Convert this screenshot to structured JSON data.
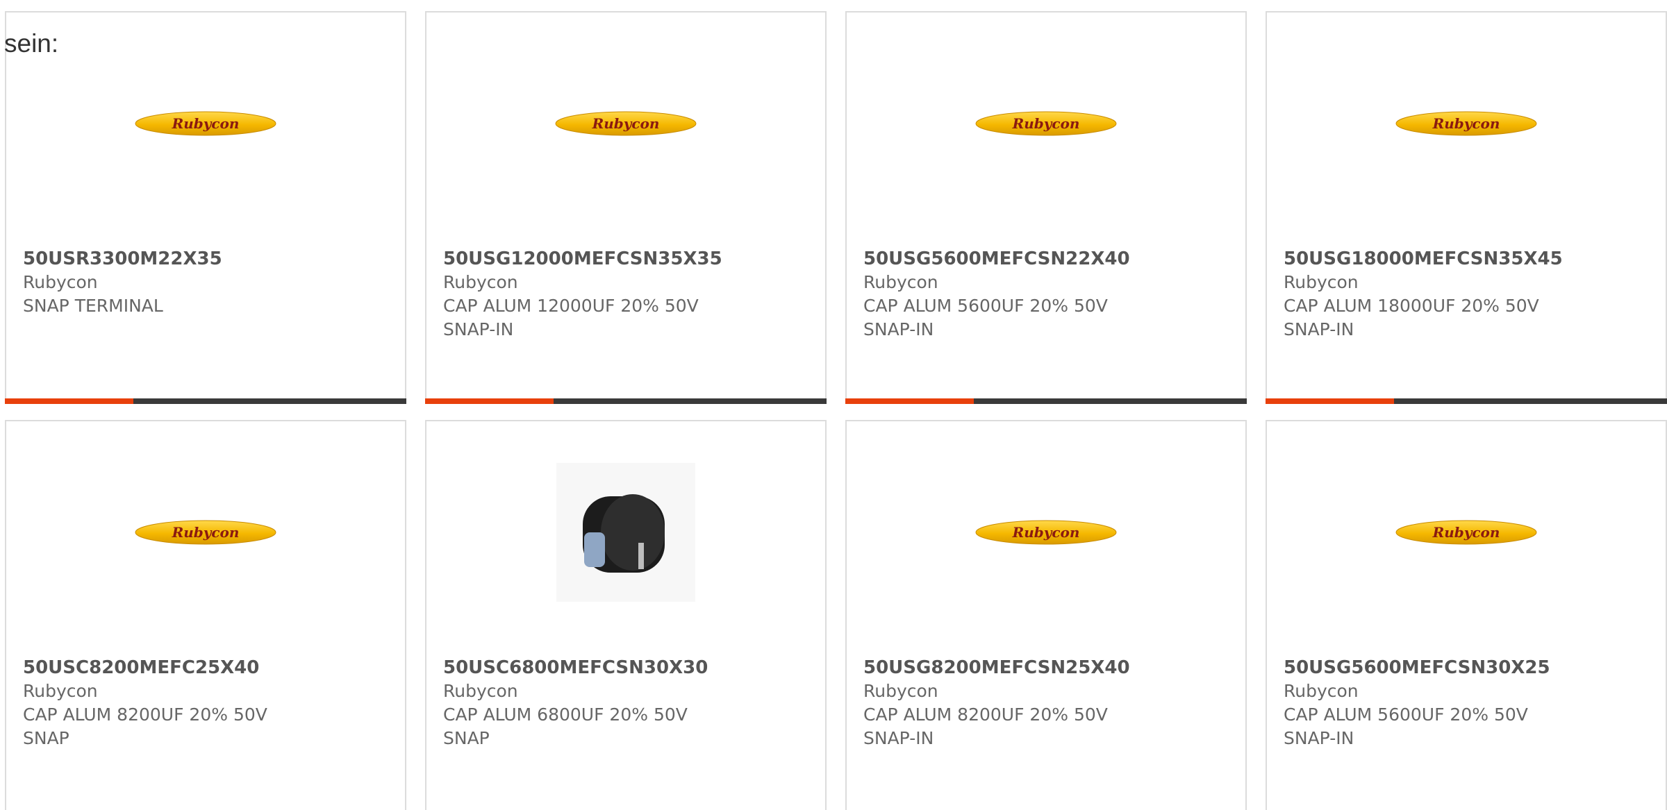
{
  "intro_text": "sein:",
  "colors": {
    "card_border": "#dcdcdc",
    "progress_track": "#3a3a3a",
    "progress_fill": "#e8400c",
    "logo_yellow": "#f5b800",
    "logo_text": "#8a1a10"
  },
  "products": [
    {
      "part_number": "50USR3300M22X35",
      "manufacturer": "Rubycon",
      "desc_line1": "SNAP TERMINAL",
      "desc_line2": "",
      "image": "rubycon-logo",
      "logo_text": "Rubycon",
      "progress": 0.32
    },
    {
      "part_number": "50USG12000MEFCSN35X35",
      "manufacturer": "Rubycon",
      "desc_line1": "CAP ALUM 12000UF 20% 50V",
      "desc_line2": "SNAP-IN",
      "image": "rubycon-logo",
      "logo_text": "Rubycon",
      "progress": 0.32
    },
    {
      "part_number": "50USG5600MEFCSN22X40",
      "manufacturer": "Rubycon",
      "desc_line1": "CAP ALUM 5600UF 20% 50V",
      "desc_line2": "SNAP-IN",
      "image": "rubycon-logo",
      "logo_text": "Rubycon",
      "progress": 0.32
    },
    {
      "part_number": "50USG18000MEFCSN35X45",
      "manufacturer": "Rubycon",
      "desc_line1": "CAP ALUM 18000UF 20% 50V",
      "desc_line2": "SNAP-IN",
      "image": "rubycon-logo",
      "logo_text": "Rubycon",
      "progress": 0.32
    },
    {
      "part_number": "50USC8200MEFC25X40",
      "manufacturer": "Rubycon",
      "desc_line1": "CAP ALUM 8200UF 20% 50V",
      "desc_line2": "SNAP",
      "image": "rubycon-logo",
      "logo_text": "Rubycon"
    },
    {
      "part_number": "50USC6800MEFCSN30X30",
      "manufacturer": "Rubycon",
      "desc_line1": "CAP ALUM 6800UF 20% 50V",
      "desc_line2": "SNAP",
      "image": "capacitor-photo"
    },
    {
      "part_number": "50USG8200MEFCSN25X40",
      "manufacturer": "Rubycon",
      "desc_line1": "CAP ALUM 8200UF 20% 50V",
      "desc_line2": "SNAP-IN",
      "image": "rubycon-logo",
      "logo_text": "Rubycon"
    },
    {
      "part_number": "50USG5600MEFCSN30X25",
      "manufacturer": "Rubycon",
      "desc_line1": "CAP ALUM 5600UF 20% 50V",
      "desc_line2": "SNAP-IN",
      "image": "rubycon-logo",
      "logo_text": "Rubycon"
    }
  ]
}
